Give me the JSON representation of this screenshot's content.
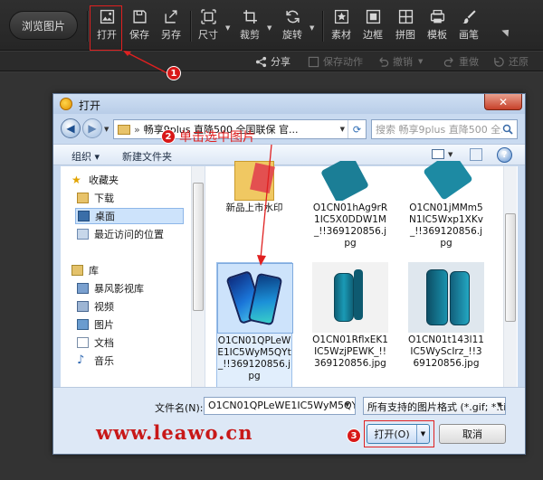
{
  "toolbar": {
    "browse_label": "浏览图片",
    "tools": [
      {
        "id": "open",
        "label": "打开",
        "icon": "open-image-icon"
      },
      {
        "id": "save",
        "label": "保存",
        "icon": "save-icon"
      },
      {
        "id": "saveas",
        "label": "另存",
        "icon": "save-as-icon"
      },
      {
        "id": "size",
        "label": "尺寸",
        "icon": "resize-icon"
      },
      {
        "id": "crop",
        "label": "裁剪",
        "icon": "crop-icon"
      },
      {
        "id": "rotate",
        "label": "旋转",
        "icon": "rotate-icon"
      },
      {
        "id": "material",
        "label": "素材",
        "icon": "star-icon"
      },
      {
        "id": "border",
        "label": "边框",
        "icon": "border-icon"
      },
      {
        "id": "collage",
        "label": "拼图",
        "icon": "collage-icon"
      },
      {
        "id": "template",
        "label": "模板",
        "icon": "template-icon"
      },
      {
        "id": "brush",
        "label": "画笔",
        "icon": "brush-icon"
      }
    ]
  },
  "secondary_bar": {
    "share": "分享",
    "save_action": "保存动作",
    "undo": "撤销",
    "redo": "重做",
    "restore": "还原"
  },
  "dialog": {
    "title": "打开",
    "address_path": "畅享9plus 直降500 全国联保 官...",
    "search_placeholder": "搜索 畅享9plus 直降500 全...",
    "organize": "组织 ▾",
    "new_folder": "新建文件夹",
    "nav": {
      "favorites": "收藏夹",
      "downloads": "下载",
      "desktop": "桌面",
      "recent": "最近访问的位置",
      "libraries": "库",
      "storm": "暴风影视库",
      "videos": "视频",
      "pictures": "图片",
      "documents": "文档",
      "music": "音乐"
    },
    "files": [
      {
        "name": "新品上市水印",
        "kind": "folder"
      },
      {
        "name": "O1CN01hAg9rR1IC5X0DDW1M_!!369120856.jpg",
        "kind": "phone-top"
      },
      {
        "name": "O1CN01jMMm5N1IC5Wxp1XKv_!!369120856.jpg",
        "kind": "phone-top"
      },
      {
        "name": "O1CN01QPLeWE1IC5WyM5QYt_!!369120856.jpg",
        "kind": "phone-screen",
        "selected": true
      },
      {
        "name": "O1CN01RflxEK1IC5WzjPEWK_!!369120856.jpg",
        "kind": "phone-back"
      },
      {
        "name": "O1CN01t143l11IC5WyScIrz_!!369120856.jpg",
        "kind": "phone-back"
      }
    ],
    "filename_label": "文件名(N):",
    "filename_value": "O1CN01QPLeWE1IC5WyM5QY",
    "filter_value": "所有支持的图片格式 (*.gif; *.tif",
    "open_button": "打开(O)",
    "cancel_button": "取消"
  },
  "annotations": {
    "step1": "1",
    "step2": "2",
    "step2_text": "单击选中图片",
    "step3": "3",
    "highlight_color": "#e02020"
  },
  "watermark": "www.leawo.cn"
}
